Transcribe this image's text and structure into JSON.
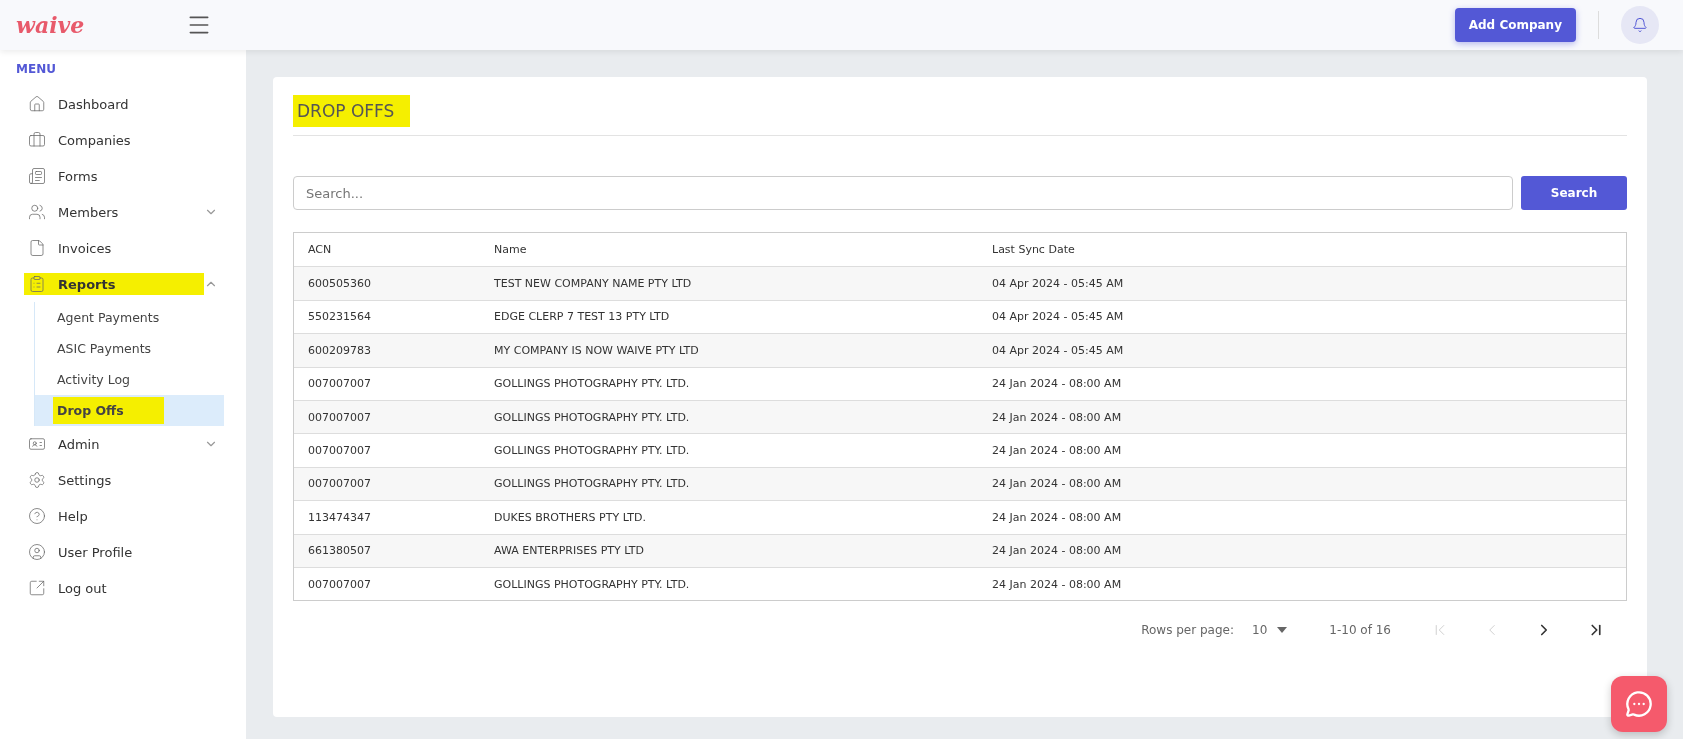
{
  "header": {
    "logo": "waive",
    "add_button": "Add Company"
  },
  "sidebar": {
    "heading": "MENU",
    "items": [
      {
        "label": "Dashboard",
        "highlighted": false
      },
      {
        "label": "Companies",
        "highlighted": false
      },
      {
        "label": "Forms",
        "highlighted": false
      },
      {
        "label": "Members",
        "highlighted": false,
        "expanded": false
      },
      {
        "label": "Invoices",
        "highlighted": false
      },
      {
        "label": "Reports",
        "highlighted": true,
        "expanded": true,
        "children": [
          {
            "label": "Agent Payments",
            "selected": false,
            "highlighted": false
          },
          {
            "label": "ASIC Payments",
            "selected": false,
            "highlighted": false
          },
          {
            "label": "Activity Log",
            "selected": false,
            "highlighted": false
          },
          {
            "label": "Drop Offs",
            "selected": true,
            "highlighted": true
          }
        ]
      },
      {
        "label": "Admin",
        "highlighted": false,
        "expanded": false
      },
      {
        "label": "Settings",
        "highlighted": false
      },
      {
        "label": "Help",
        "highlighted": false
      },
      {
        "label": "User Profile",
        "highlighted": false
      },
      {
        "label": "Log out",
        "highlighted": false
      }
    ]
  },
  "page": {
    "title": "DROP OFFS",
    "title_highlighted": true,
    "search": {
      "placeholder": "Search...",
      "button": "Search"
    }
  },
  "table": {
    "columns": [
      "ACN",
      "Name",
      "Last Sync Date"
    ],
    "rows": [
      [
        "600505360",
        "TEST NEW COMPANY NAME PTY LTD",
        "04 Apr 2024 - 05:45 AM"
      ],
      [
        "550231564",
        "EDGE CLERP 7 TEST 13 PTY LTD",
        "04 Apr 2024 - 05:45 AM"
      ],
      [
        "600209783",
        "MY COMPANY IS NOW WAIVE PTY LTD",
        "04 Apr 2024 - 05:45 AM"
      ],
      [
        "007007007",
        "GOLLINGS PHOTOGRAPHY PTY. LTD.",
        "24 Jan 2024 - 08:00 AM"
      ],
      [
        "007007007",
        "GOLLINGS PHOTOGRAPHY PTY. LTD.",
        "24 Jan 2024 - 08:00 AM"
      ],
      [
        "007007007",
        "GOLLINGS PHOTOGRAPHY PTY. LTD.",
        "24 Jan 2024 - 08:00 AM"
      ],
      [
        "007007007",
        "GOLLINGS PHOTOGRAPHY PTY. LTD.",
        "24 Jan 2024 - 08:00 AM"
      ],
      [
        "113474347",
        "DUKES BROTHERS PTY LTD.",
        "24 Jan 2024 - 08:00 AM"
      ],
      [
        "661380507",
        "AWA ENTERPRISES PTY LTD",
        "24 Jan 2024 - 08:00 AM"
      ],
      [
        "007007007",
        "GOLLINGS PHOTOGRAPHY PTY. LTD.",
        "24 Jan 2024 - 08:00 AM"
      ]
    ]
  },
  "pagination": {
    "rows_label": "Rows per page:",
    "rows_value": "10",
    "range": "1-10 of 16",
    "nav": [
      {
        "disabled": true
      },
      {
        "disabled": true
      },
      {
        "disabled": false
      },
      {
        "disabled": false
      }
    ]
  }
}
